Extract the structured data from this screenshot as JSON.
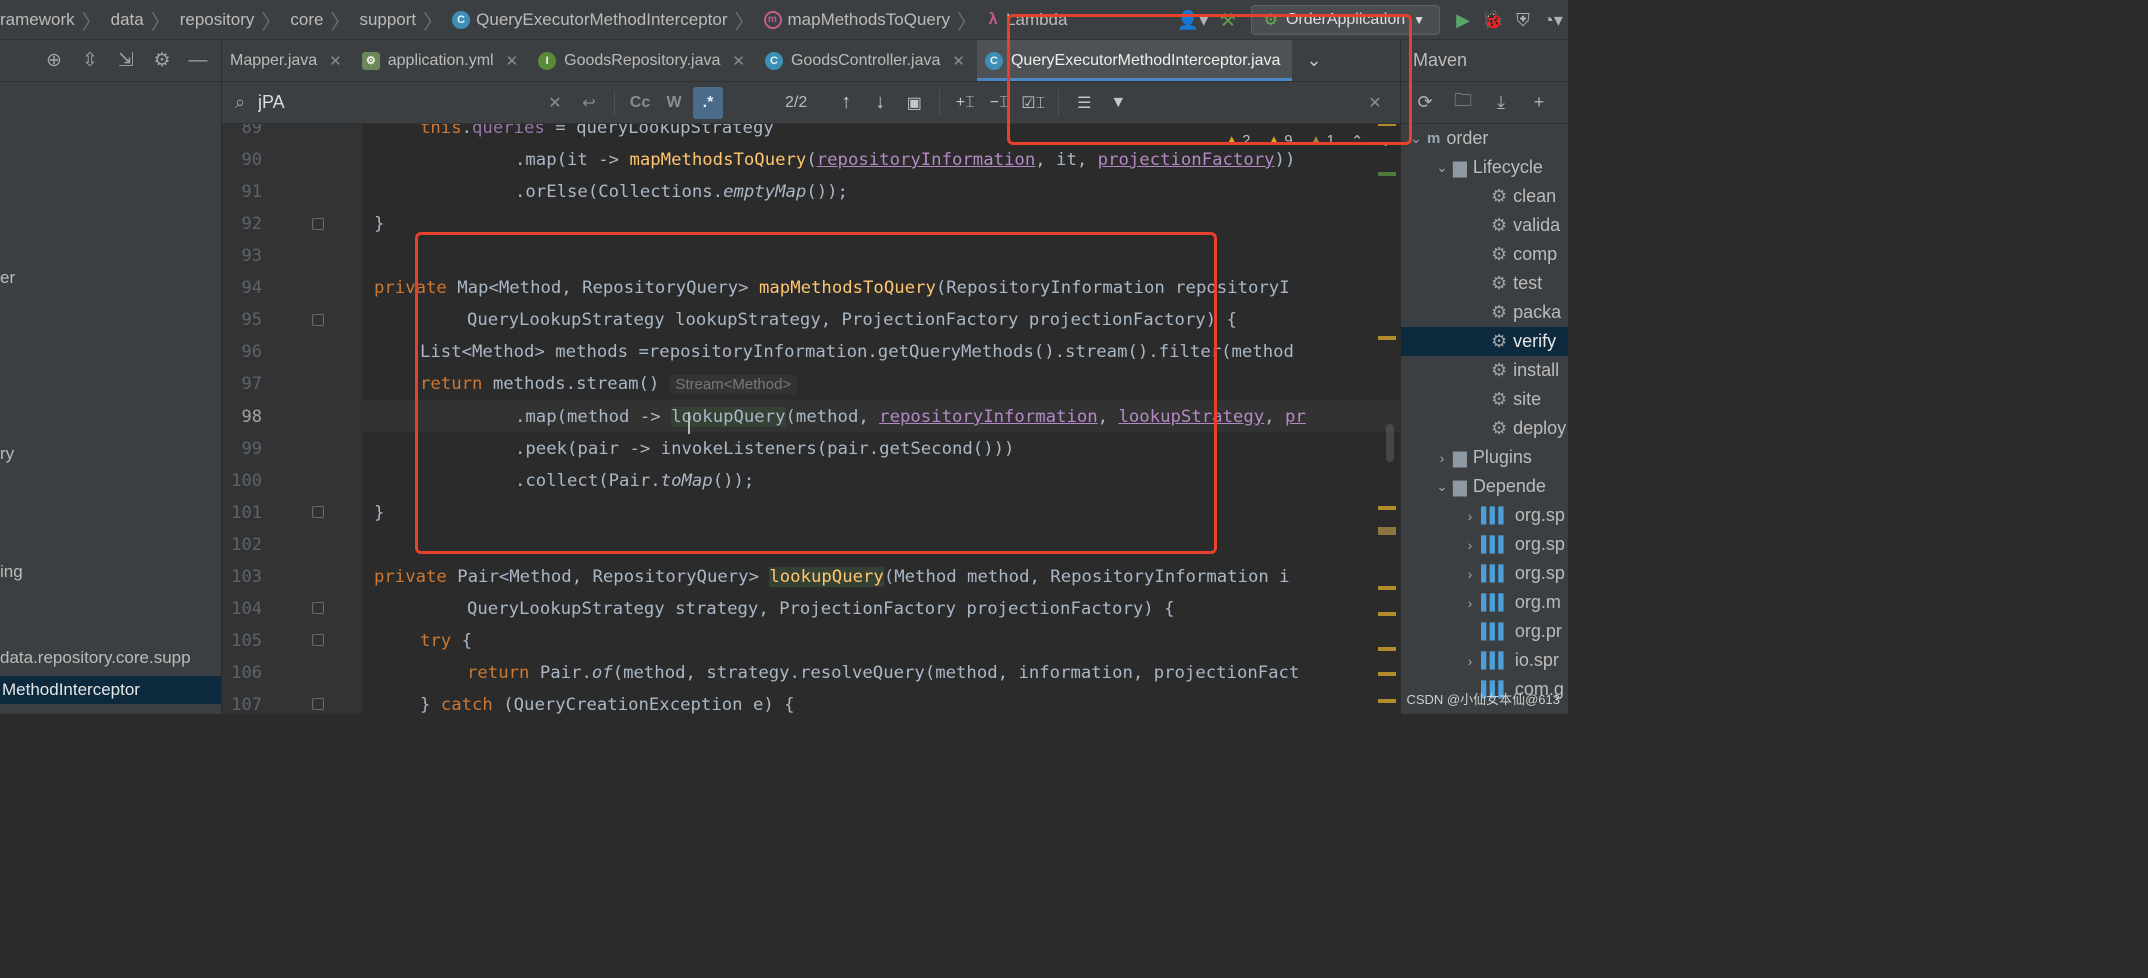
{
  "breadcrumb": [
    {
      "label": "ramework",
      "icon": ""
    },
    {
      "label": "data",
      "icon": ""
    },
    {
      "label": "repository",
      "icon": ""
    },
    {
      "label": "core",
      "icon": ""
    },
    {
      "label": "support",
      "icon": ""
    },
    {
      "label": "QueryExecutorMethodInterceptor",
      "icon": "class-icon"
    },
    {
      "label": "mapMethodsToQuery",
      "icon": "method-icon"
    },
    {
      "label": "Lambda",
      "icon": "lambda-icon"
    }
  ],
  "run_config": {
    "name": "OrderApplication"
  },
  "project_tree": {
    "items": [
      {
        "label": "er"
      },
      {
        "label": "ry"
      },
      {
        "label": "ing"
      },
      {
        "label": "data.repository.core.supp"
      },
      {
        "label": "MethodInterceptor",
        "selected": true
      }
    ]
  },
  "tabs": [
    {
      "label": "Mapper.java",
      "icon": "",
      "active": false
    },
    {
      "label": "application.yml",
      "icon": "yml-icon",
      "active": false
    },
    {
      "label": "GoodsRepository.java",
      "icon": "interface-icon",
      "icon_letter": "I",
      "active": false
    },
    {
      "label": "GoodsController.java",
      "icon": "class-icon",
      "icon_letter": "C",
      "active": false
    },
    {
      "label": "QueryExecutorMethodInterceptor.java",
      "icon": "class-icon",
      "icon_letter": "C",
      "active": true
    }
  ],
  "find": {
    "query": "jPA",
    "match_case_label": "Cc",
    "words_label": "W",
    "regex_label": ".*",
    "count": "2/2"
  },
  "inspections": {
    "errors": "2",
    "warnings": "9",
    "weak": "1"
  },
  "lines": [
    {
      "n": "89"
    },
    {
      "n": "90"
    },
    {
      "n": "91"
    },
    {
      "n": "92"
    },
    {
      "n": "93"
    },
    {
      "n": "94"
    },
    {
      "n": "95"
    },
    {
      "n": "96"
    },
    {
      "n": "97"
    },
    {
      "n": "98"
    },
    {
      "n": "99"
    },
    {
      "n": "100"
    },
    {
      "n": "101"
    },
    {
      "n": "102"
    },
    {
      "n": "103"
    },
    {
      "n": "104"
    },
    {
      "n": "105"
    },
    {
      "n": "106"
    },
    {
      "n": "107"
    }
  ],
  "code": {
    "l89": {
      "kw": "this",
      "dot": ".",
      "fld": "queries",
      "rest": " = queryLookupStrategy"
    },
    "l90": {
      "a": ".map(it -> ",
      "fn": "mapMethodsToQuery",
      "b": "(",
      "u1": "repositoryInformation",
      "c": ", it, ",
      "u2": "projectionFactory",
      "d": "))"
    },
    "l91": {
      "a": ".orElse(Collections.",
      "it": "emptyMap",
      "b": "());"
    },
    "l92": {
      "a": "}"
    },
    "l94": {
      "kw": "private",
      "a": " Map<Method, RepositoryQuery> ",
      "fn": "mapMethodsToQuery",
      "b": "(RepositoryInformation repositoryI"
    },
    "l95": {
      "a": "QueryLookupStrategy lookupStrategy, ProjectionFactory projectionFactory) {"
    },
    "l96": {
      "a": "List<Method> methods =repositoryInformation.getQueryMethods().stream().filter(method"
    },
    "l97": {
      "kw": "return",
      "a": " methods.stream()",
      "hint": "Stream<Method>"
    },
    "l98": {
      "a": ".map(method -> ",
      "b": "lookupQuery",
      "c": "(method, ",
      "u1": "repositoryInformation",
      "d": ", ",
      "u2": "lookupStrategy",
      "e": ", ",
      "u3": "pr"
    },
    "l99": {
      "a": ".peek(pair -> invokeListeners(pair.getSecond()))"
    },
    "l100": {
      "a": ".collect(Pair.",
      "it": "toMap",
      "b": "());"
    },
    "l101": {
      "a": "}"
    },
    "l103": {
      "kw": "private",
      "a": " Pair<Method, RepositoryQuery> ",
      "fn": "lookupQuery",
      "b": "(Method method, RepositoryInformation i"
    },
    "l104": {
      "a": "QueryLookupStrategy strategy, ProjectionFactory projectionFactory) {"
    },
    "l105": {
      "kw": "try",
      "a": " {"
    },
    "l106": {
      "kw": "return",
      "a": " Pair.",
      "it": "of",
      "b": "(method, strategy.resolveQuery(method, information, projectionFact"
    },
    "l107": {
      "a": "} ",
      "kw": "catch",
      "b": " (QueryCreationException e) {"
    }
  },
  "maven": {
    "title": "Maven",
    "tree": [
      {
        "label": "order",
        "icon": "maven-module-icon",
        "expanded": true
      },
      {
        "label": "Lifecycle",
        "icon": "folder-icon",
        "expanded": true
      },
      {
        "label": "clean",
        "icon": "gear-icon"
      },
      {
        "label": "valida",
        "icon": "gear-icon"
      },
      {
        "label": "comp",
        "icon": "gear-icon"
      },
      {
        "label": "test",
        "icon": "gear-icon"
      },
      {
        "label": "packa",
        "icon": "gear-icon"
      },
      {
        "label": "verify",
        "icon": "gear-icon",
        "selected": true
      },
      {
        "label": "install",
        "icon": "gear-icon"
      },
      {
        "label": "site",
        "icon": "gear-icon"
      },
      {
        "label": "deploy",
        "icon": "gear-icon"
      },
      {
        "label": "Plugins",
        "icon": "folder-icon",
        "expanded": false
      },
      {
        "label": "Depende",
        "icon": "folder-icon",
        "expanded": true
      },
      {
        "label": "org.sp",
        "icon": "library-icon"
      },
      {
        "label": "org.sp",
        "icon": "library-icon"
      },
      {
        "label": "org.sp",
        "icon": "library-icon"
      },
      {
        "label": "org.m",
        "icon": "library-icon"
      },
      {
        "label": "org.pr",
        "icon": "library-icon"
      },
      {
        "label": "io.spr",
        "icon": "library-icon"
      },
      {
        "label": "com.g",
        "icon": "library-icon"
      }
    ]
  },
  "watermark": "CSDN @小仙女本仙@613",
  "colors": {
    "annotation": "#e6402e",
    "accent": "#4a88c7",
    "keyword": "#cc7832",
    "method": "#ffc66d"
  }
}
